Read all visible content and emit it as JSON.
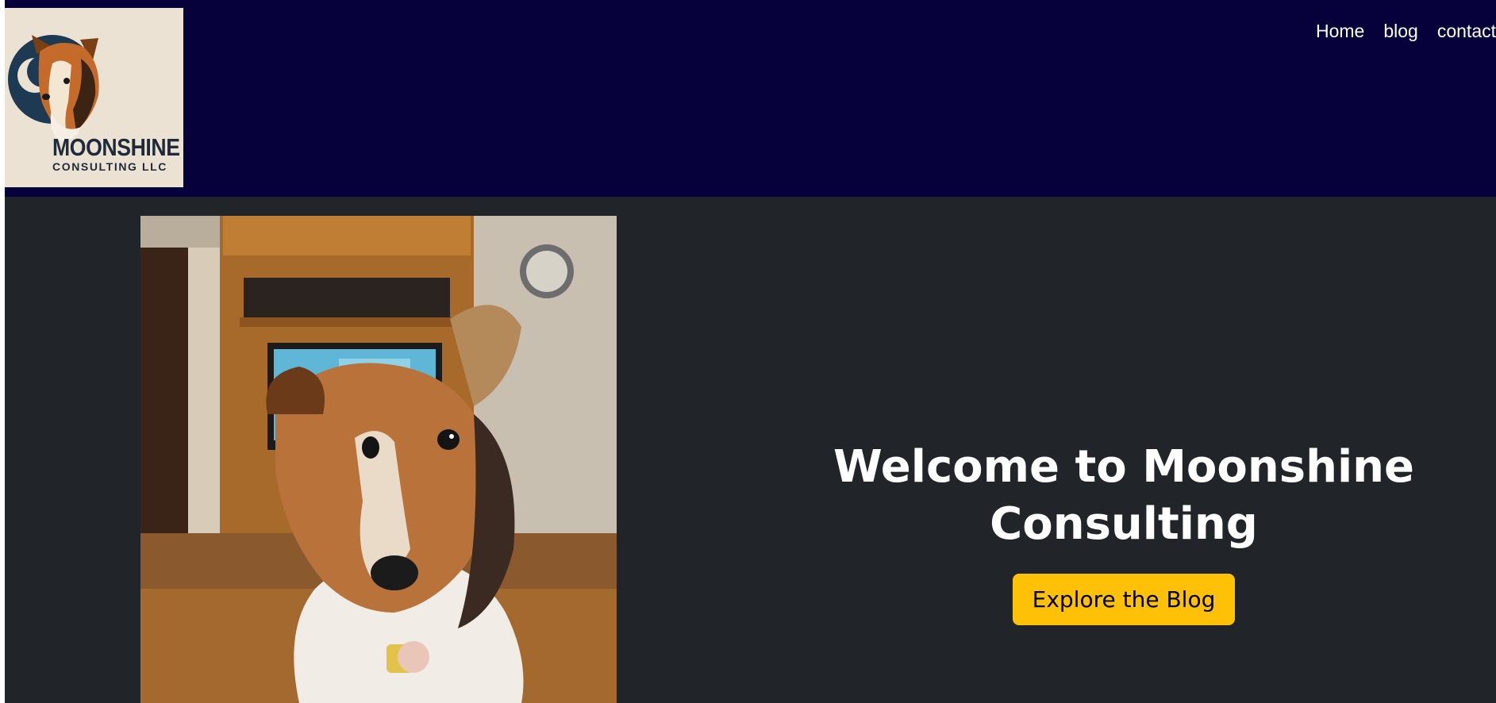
{
  "header": {
    "logo": {
      "line1": "MOONSHINE",
      "line2": "CONSULTING LLC"
    },
    "nav": [
      {
        "label": "Home"
      },
      {
        "label": "blog"
      },
      {
        "label": "contact"
      }
    ]
  },
  "hero": {
    "title": "Welcome to Moonshine Consulting",
    "button_label": "Explore the Blog"
  },
  "colors": {
    "header_bg": "#06003b",
    "hero_bg": "#212529",
    "button_bg": "#ffc107",
    "logo_bg": "#ebe2d4"
  }
}
